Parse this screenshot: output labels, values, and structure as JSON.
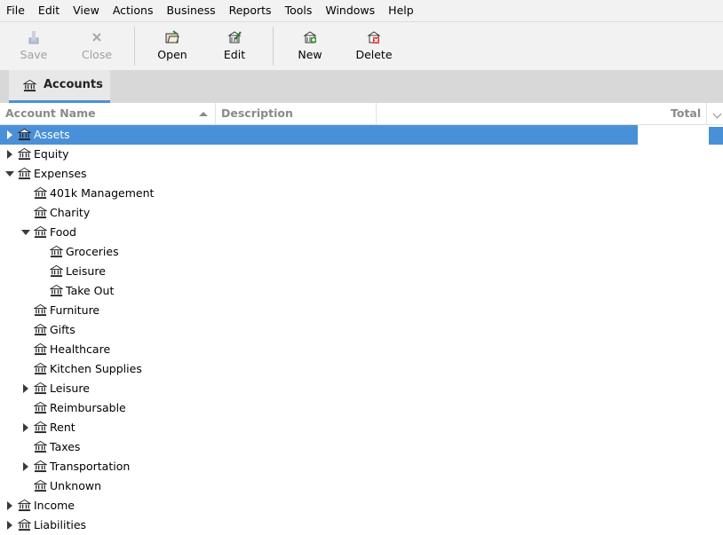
{
  "menu": [
    "File",
    "Edit",
    "View",
    "Actions",
    "Business",
    "Reports",
    "Tools",
    "Windows",
    "Help"
  ],
  "toolbar": {
    "save": "Save",
    "close": "Close",
    "open": "Open",
    "edit": "Edit",
    "new": "New",
    "delete": "Delete"
  },
  "tab": {
    "label": "Accounts"
  },
  "columns": {
    "account_name": "Account Name",
    "description": "Description",
    "total": "Total"
  },
  "accent_color": "#4a90d9",
  "tree": [
    {
      "label": "Assets",
      "state": "collapsed",
      "selected": true
    },
    {
      "label": "Equity",
      "state": "collapsed"
    },
    {
      "label": "Expenses",
      "state": "expanded"
    },
    {
      "label": "401k Management",
      "state": "leaf"
    },
    {
      "label": "Charity",
      "state": "leaf"
    },
    {
      "label": "Food",
      "state": "expanded"
    },
    {
      "label": "Groceries",
      "state": "leaf"
    },
    {
      "label": "Leisure",
      "state": "leaf"
    },
    {
      "label": "Take Out",
      "state": "leaf"
    },
    {
      "label": "Furniture",
      "state": "leaf"
    },
    {
      "label": "Gifts",
      "state": "leaf"
    },
    {
      "label": "Healthcare",
      "state": "leaf"
    },
    {
      "label": "Kitchen Supplies",
      "state": "leaf"
    },
    {
      "label": "Leisure",
      "state": "collapsed"
    },
    {
      "label": "Reimbursable",
      "state": "leaf"
    },
    {
      "label": "Rent",
      "state": "collapsed"
    },
    {
      "label": "Taxes",
      "state": "leaf"
    },
    {
      "label": "Transportation",
      "state": "collapsed"
    },
    {
      "label": "Unknown",
      "state": "leaf"
    },
    {
      "label": "Income",
      "state": "collapsed"
    },
    {
      "label": "Liabilities",
      "state": "collapsed"
    }
  ]
}
